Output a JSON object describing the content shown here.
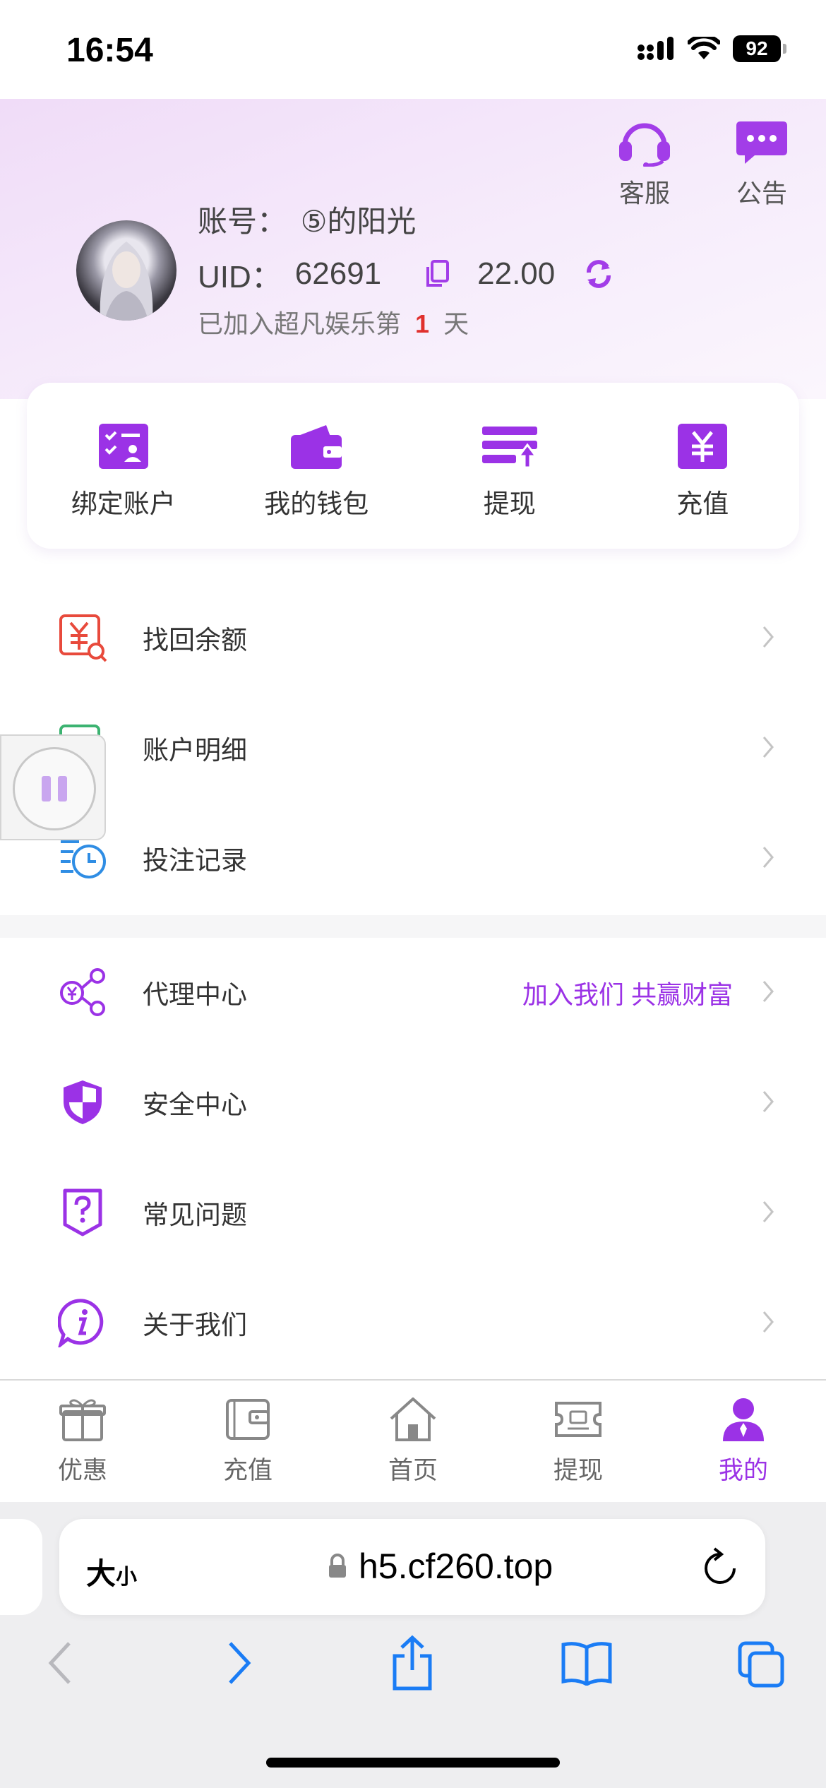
{
  "status_bar": {
    "time": "16:54",
    "battery": "92"
  },
  "header": {
    "service_label": "客服",
    "notice_label": "公告",
    "account_label": "账号：",
    "account_name": "⑤的阳光",
    "uid_label": "UID：",
    "uid_value": "62691",
    "balance": "22.00",
    "joined_prefix": "已加入超凡娱乐第",
    "joined_days": "1",
    "joined_suffix": "天"
  },
  "quick_actions": [
    {
      "label": "绑定账户",
      "icon": "bind-account-icon"
    },
    {
      "label": "我的钱包",
      "icon": "wallet-icon"
    },
    {
      "label": "提现",
      "icon": "withdraw-icon"
    },
    {
      "label": "充值",
      "icon": "recharge-icon"
    }
  ],
  "menu_group_1": [
    {
      "label": "找回余额",
      "icon": "recover-balance-icon"
    },
    {
      "label": "账户明细",
      "icon": "account-detail-icon"
    },
    {
      "label": "投注记录",
      "icon": "bet-record-icon"
    }
  ],
  "menu_group_2": [
    {
      "label": "代理中心",
      "icon": "agent-center-icon",
      "extra": "加入我们 共赢财富"
    },
    {
      "label": "安全中心",
      "icon": "security-shield-icon"
    },
    {
      "label": "常见问题",
      "icon": "faq-icon"
    },
    {
      "label": "关于我们",
      "icon": "about-info-icon"
    }
  ],
  "tab_bar": [
    {
      "label": "优惠",
      "icon": "gift-icon",
      "active": false
    },
    {
      "label": "充值",
      "icon": "wallet-tab-icon",
      "active": false
    },
    {
      "label": "首页",
      "icon": "home-icon",
      "active": false
    },
    {
      "label": "提现",
      "icon": "ticket-icon",
      "active": false
    },
    {
      "label": "我的",
      "icon": "profile-icon",
      "active": true
    }
  ],
  "browser": {
    "text_size_label_big": "大",
    "text_size_label_small": "小",
    "url": "h5.cf260.top"
  },
  "colors": {
    "accent_purple": "#9b32e6",
    "days_red": "#e0302d",
    "recover_red": "#e84a3c",
    "detail_green": "#3cb371",
    "record_blue": "#2f8de4",
    "safari_blue": "#1a7cf5"
  }
}
